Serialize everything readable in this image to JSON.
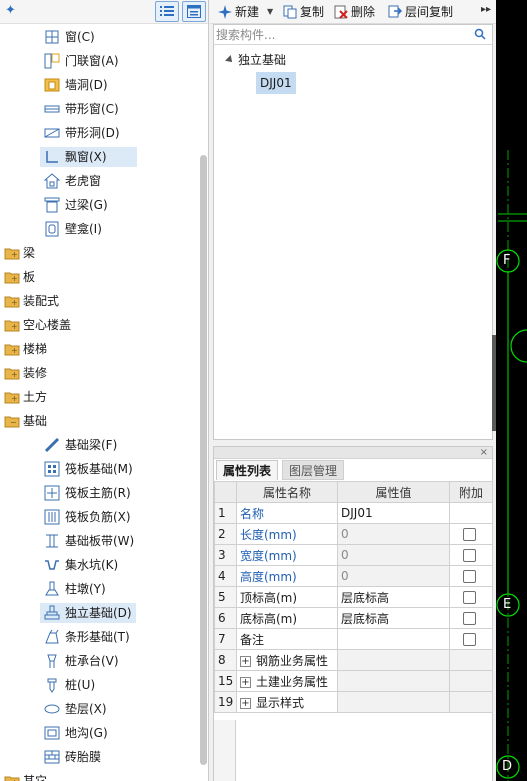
{
  "left_panel": {
    "tree_children_top": [
      {
        "label": "窗(C)",
        "icon": "window-icon"
      },
      {
        "label": "门联窗(A)",
        "icon": "door-window-icon"
      },
      {
        "label": "墙洞(D)",
        "icon": "wall-opening-icon"
      },
      {
        "label": "带形窗(C)",
        "icon": "strip-window-icon"
      },
      {
        "label": "带形洞(D)",
        "icon": "strip-opening-icon"
      },
      {
        "label": "飘窗(X)",
        "icon": "bay-window-icon",
        "selected": true
      },
      {
        "label": "老虎窗",
        "icon": "dormer-icon"
      },
      {
        "label": "过梁(G)",
        "icon": "lintel-icon"
      },
      {
        "label": "壁龛(I)",
        "icon": "niche-icon"
      }
    ],
    "categories": [
      {
        "label": "梁"
      },
      {
        "label": "板"
      },
      {
        "label": "装配式"
      },
      {
        "label": "空心楼盖"
      },
      {
        "label": "楼梯"
      },
      {
        "label": "装修"
      },
      {
        "label": "土方"
      },
      {
        "label": "基础",
        "expanded": true
      }
    ],
    "tree_children_foundation": [
      {
        "label": "基础梁(F)",
        "icon": "foundation-beam-icon"
      },
      {
        "label": "筏板基础(M)",
        "icon": "raft-foundation-icon"
      },
      {
        "label": "筏板主筋(R)",
        "icon": "raft-main-rebar-icon"
      },
      {
        "label": "筏板负筋(X)",
        "icon": "raft-negative-rebar-icon"
      },
      {
        "label": "基础板带(W)",
        "icon": "foundation-strip-icon"
      },
      {
        "label": "集水坑(K)",
        "icon": "sump-pit-icon"
      },
      {
        "label": "柱墩(Y)",
        "icon": "column-pier-icon"
      },
      {
        "label": "独立基础(D)",
        "icon": "isolated-foundation-icon",
        "selected": true
      },
      {
        "label": "条形基础(T)",
        "icon": "strip-foundation-icon"
      },
      {
        "label": "桩承台(V)",
        "icon": "pile-cap-icon"
      },
      {
        "label": "桩(U)",
        "icon": "pile-icon"
      },
      {
        "label": "垫层(X)",
        "icon": "cushion-icon"
      },
      {
        "label": "地沟(G)",
        "icon": "trench-icon"
      },
      {
        "label": "砖胎膜",
        "icon": "brick-mold-icon"
      }
    ],
    "partial_bottom_label": "其它"
  },
  "mid_toolbar": {
    "new_label": "新建",
    "copy_label": "复制",
    "delete_label": "删除",
    "floor_copy_label": "层间复制"
  },
  "component_panel": {
    "search_placeholder": "搜索构件...",
    "group_label": "独立基础",
    "instance_label": "DJJ01"
  },
  "properties": {
    "tab_active": "属性列表",
    "tab_inactive": "图层管理",
    "close_glyph": "×",
    "headers": {
      "name": "属性名称",
      "value": "属性值",
      "extra": "附加"
    },
    "rows": [
      {
        "num": "1",
        "name": "名称",
        "value": "DJJ01",
        "blue": true,
        "checkbox": false
      },
      {
        "num": "2",
        "name": "长度(mm)",
        "value": "0",
        "blue": true,
        "grey": true,
        "checkbox": true
      },
      {
        "num": "3",
        "name": "宽度(mm)",
        "value": "0",
        "blue": true,
        "grey": true,
        "checkbox": true
      },
      {
        "num": "4",
        "name": "高度(mm)",
        "value": "0",
        "blue": true,
        "grey": true,
        "checkbox": true
      },
      {
        "num": "5",
        "name": "顶标高(m)",
        "value": "层底标高",
        "checkbox": true
      },
      {
        "num": "6",
        "name": "底标高(m)",
        "value": "层底标高",
        "checkbox": true
      },
      {
        "num": "7",
        "name": "备注",
        "value": "",
        "checkbox": true
      },
      {
        "num": "8",
        "name": "钢筋业务属性",
        "value": "",
        "group": true
      },
      {
        "num": "15",
        "name": "土建业务属性",
        "value": "",
        "group": true
      },
      {
        "num": "19",
        "name": "显示样式",
        "value": "",
        "group": true
      }
    ]
  },
  "canvas": {
    "axis_labels": [
      "F",
      "E",
      "D"
    ],
    "background": "#000000",
    "axis_color": "#00e000"
  },
  "colors": {
    "selection": "#dce9f7",
    "instance_selection": "#c5dbf2",
    "blue_text": "#1f5fb3",
    "folder": "#e8b54a"
  }
}
